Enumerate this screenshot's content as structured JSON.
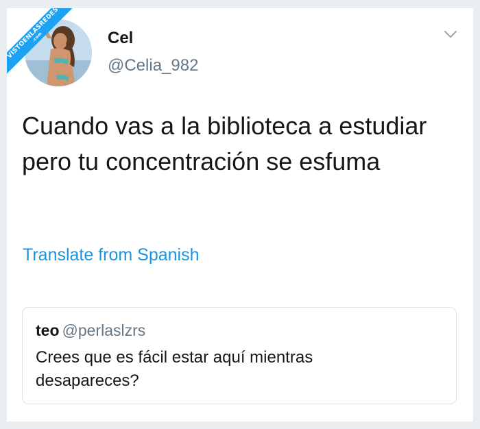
{
  "watermark": {
    "text": "VISTOENLASREDES",
    "subtext": ".com"
  },
  "tweet": {
    "author_name": "Cel",
    "author_handle": "@Celia_982",
    "text": "Cuando vas a la biblioteca a estudiar pero tu concentración se esfuma",
    "translate_link": "Translate from Spanish",
    "menu_icon": "chevron-down-icon"
  },
  "quoted_tweet": {
    "author_name": "teo",
    "author_handle": "@perlaslzrs",
    "text": "Crees que es fácil estar aquí mientras desapareces?"
  },
  "colors": {
    "link": "#1b95e0",
    "secondary_text": "#657786",
    "primary_text": "#14171a",
    "watermark": "#1da1f2",
    "border": "#dbe1e6",
    "background": "#e9edf0"
  }
}
